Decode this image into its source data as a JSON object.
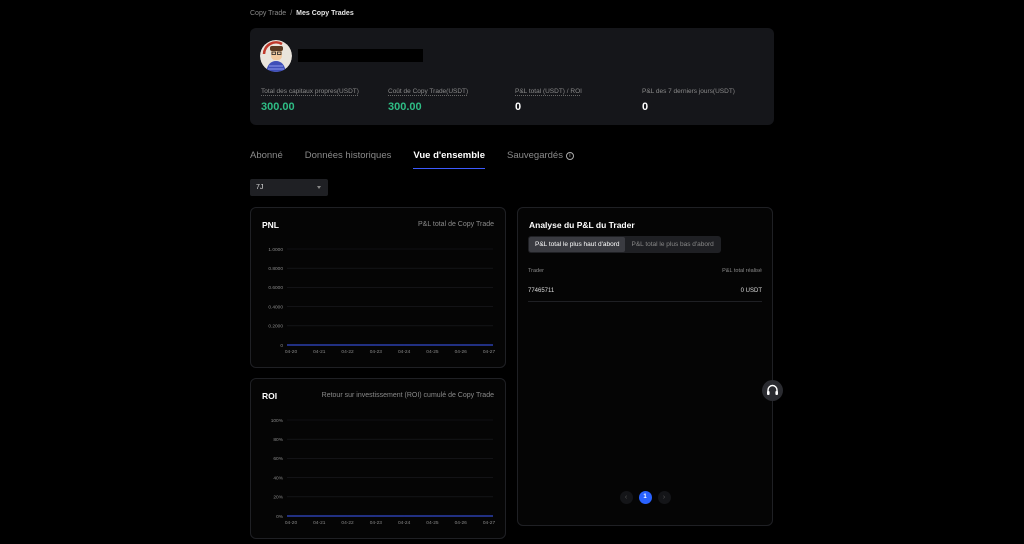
{
  "breadcrumb": {
    "parent": "Copy Trade",
    "separator": "/",
    "current": "Mes Copy Trades"
  },
  "summary": {
    "stats": [
      {
        "label": "Total des capitaux propres(USDT)",
        "value": "300.00",
        "color": "#2ebd85"
      },
      {
        "label": "Coût de Copy Trade(USDT)",
        "value": "300.00",
        "color": "#2ebd85"
      },
      {
        "label": "P&L total (USDT) / ROI",
        "value": "0",
        "color": "#ffffff"
      },
      {
        "label": "P&L des 7 derniers jours(USDT)",
        "value": "0",
        "color": "#ffffff"
      }
    ]
  },
  "tabs": [
    {
      "label": "Abonné",
      "active": false
    },
    {
      "label": "Données historiques",
      "active": false
    },
    {
      "label": "Vue d'ensemble",
      "active": true
    },
    {
      "label": "Sauvegardés",
      "active": false
    }
  ],
  "period": {
    "selected": "7J"
  },
  "pnl_card": {
    "title": "PNL",
    "subtitle": "P&L total de Copy Trade"
  },
  "roi_card": {
    "title": "ROI",
    "subtitle": "Retour sur investissement (ROI) cumulé de Copy Trade"
  },
  "analysis": {
    "title": "Analyse du P&L du Trader",
    "toggle": {
      "left": "P&L total le plus haut d'abord",
      "right": "P&L total le plus bas d'abord"
    },
    "columns": {
      "trader": "Trader",
      "pnl": "P&L total réalisé"
    },
    "rows": [
      {
        "trader": "77465711",
        "pnl": "0 USDT"
      }
    ],
    "pager": {
      "prev": "‹",
      "current": "1",
      "next": "›"
    }
  },
  "chart_data": [
    {
      "type": "line",
      "title": "PNL",
      "subtitle": "P&L total de Copy Trade",
      "x": [
        "04-20",
        "04-21",
        "04-22",
        "04-23",
        "04-24",
        "04-25",
        "04-26",
        "04-27"
      ],
      "yticks": [
        "0",
        "0.2000",
        "0.4000",
        "0.6000",
        "0.8000",
        "1.0000"
      ],
      "ylim": [
        0,
        1
      ],
      "series": [
        {
          "values": [
            0,
            0,
            0,
            0,
            0,
            0,
            0,
            0
          ],
          "color": "#3d5afe"
        }
      ],
      "grid": true
    },
    {
      "type": "line",
      "title": "ROI",
      "subtitle": "Retour sur investissement (ROI) cumulé de Copy Trade",
      "x": [
        "04-20",
        "04-21",
        "04-22",
        "04-23",
        "04-24",
        "04-25",
        "04-26",
        "04-27"
      ],
      "yticks": [
        "0%",
        "20%",
        "40%",
        "60%",
        "80%",
        "100%"
      ],
      "ylim": [
        0,
        100
      ],
      "series": [
        {
          "values": [
            0,
            0,
            0,
            0,
            0,
            0,
            0,
            0
          ],
          "color": "#3d5afe"
        }
      ],
      "grid": true
    }
  ]
}
